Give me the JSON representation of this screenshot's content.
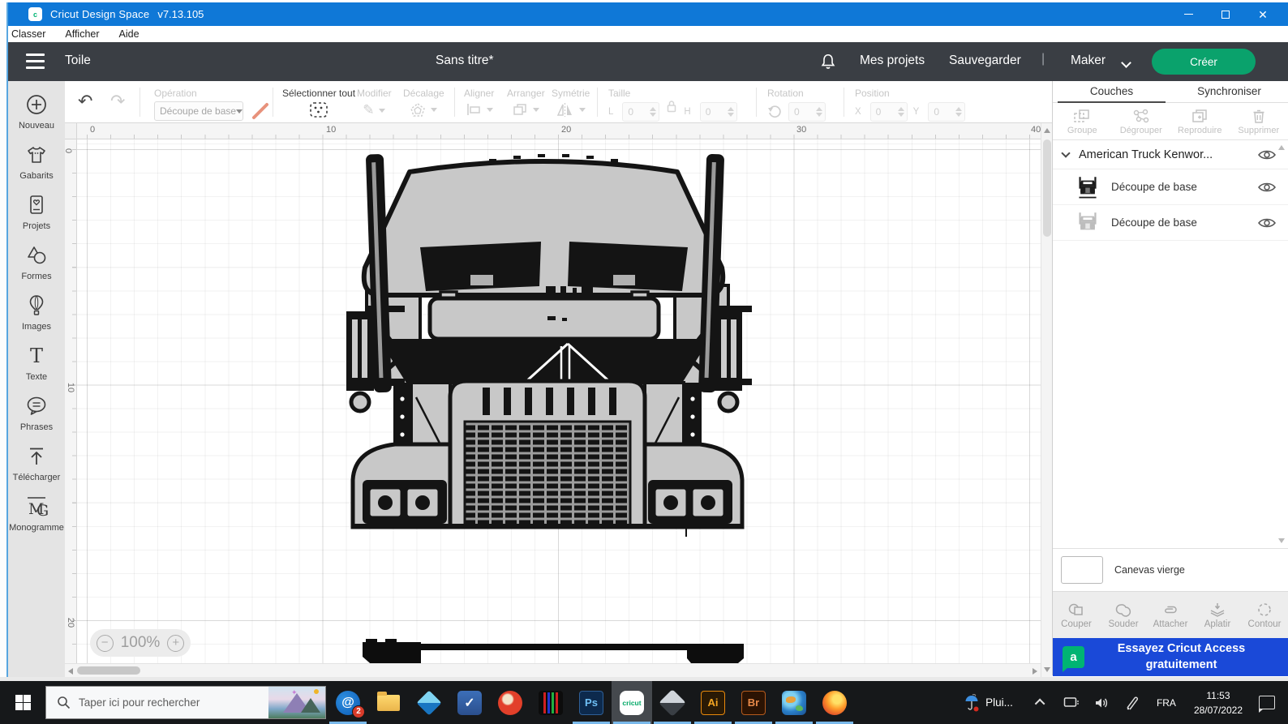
{
  "window": {
    "app_title": "Cricut Design Space",
    "version": "v7.13.105"
  },
  "menu_bar": {
    "items": [
      {
        "label": "Classer"
      },
      {
        "label": "Afficher"
      },
      {
        "label": "Aide"
      }
    ]
  },
  "app_bar": {
    "canvas_label": "Toile",
    "doc_title": "Sans titre*",
    "my_projects": "Mes projets",
    "save_label": "Sauvegarder",
    "divider": "|",
    "machine": "Maker",
    "create_label": "Créer"
  },
  "toolbar": {
    "operation_label": "Opération",
    "operation_value": "Découpe de base",
    "select_all_label": "Sélectionner tout",
    "edit_label": "Modifier",
    "offset_label": "Décalage",
    "align_label": "Aligner",
    "arrange_label": "Arranger",
    "mirror_label": "Symétrie",
    "size_label": "Taille",
    "width_prefix": "L",
    "height_prefix": "H",
    "width_value": "0",
    "height_value": "0",
    "rotation_label": "Rotation",
    "rotation_value": "0",
    "position_label": "Position",
    "x_prefix": "X",
    "y_prefix": "Y",
    "x_value": "0",
    "y_value": "0"
  },
  "glyphs": {
    "undo": "↶",
    "redo": "↷",
    "pencil": "✎",
    "zoom_out": "−",
    "zoom_in": "+",
    "logo_letter": "c",
    "check": "✓",
    "mail_swoosh": "@"
  },
  "sidebar": {
    "items": [
      {
        "label": "Nouveau"
      },
      {
        "label": "Gabarits"
      },
      {
        "label": "Projets"
      },
      {
        "label": "Formes"
      },
      {
        "label": "Images"
      },
      {
        "label": "Texte"
      },
      {
        "label": "Phrases"
      },
      {
        "label": "Télécharger"
      },
      {
        "label": "Monogramme"
      }
    ]
  },
  "canvas": {
    "h_ruler": [
      {
        "v": "0"
      },
      {
        "v": "10"
      },
      {
        "v": "20"
      },
      {
        "v": "30"
      },
      {
        "v": "40"
      }
    ],
    "v_ruler": [
      {
        "v": "0"
      },
      {
        "v": "10"
      },
      {
        "v": "20"
      }
    ],
    "zoom_level": "100%"
  },
  "layers_panel": {
    "tab_layers": "Couches",
    "tab_sync": "Synchroniser",
    "group_label": "Groupe",
    "ungroup_label": "Dégrouper",
    "duplicate_label": "Reproduire",
    "delete_label": "Supprimer",
    "group_title": "American Truck Kenwor...",
    "layers": [
      {
        "label": "Découpe de base"
      },
      {
        "label": "Découpe de base"
      }
    ],
    "canvas_layer_label": "Canevas vierge",
    "slice_label": "Couper",
    "weld_label": "Souder",
    "attach_label": "Attacher",
    "flatten_label": "Aplatir",
    "contour_label": "Contour",
    "access_banner": "Essayez Cricut Access gratuitement",
    "access_logo": "a"
  },
  "taskbar": {
    "search_placeholder": "Taper ici pour rechercher",
    "mail_badge": "2",
    "ps_label": "Ps",
    "cricut_label": "cricut",
    "ai_label": "Ai",
    "br_label": "Br",
    "weather_label": "Plui...",
    "language": "FRA",
    "time": "11:53",
    "date": "28/07/2022"
  },
  "colors": {
    "titlebar": "#0F78D7",
    "appbar": "#3A3E44",
    "accent_green": "#0AA26C",
    "banner_blue": "#1A49D8",
    "access_green": "#00B473"
  }
}
